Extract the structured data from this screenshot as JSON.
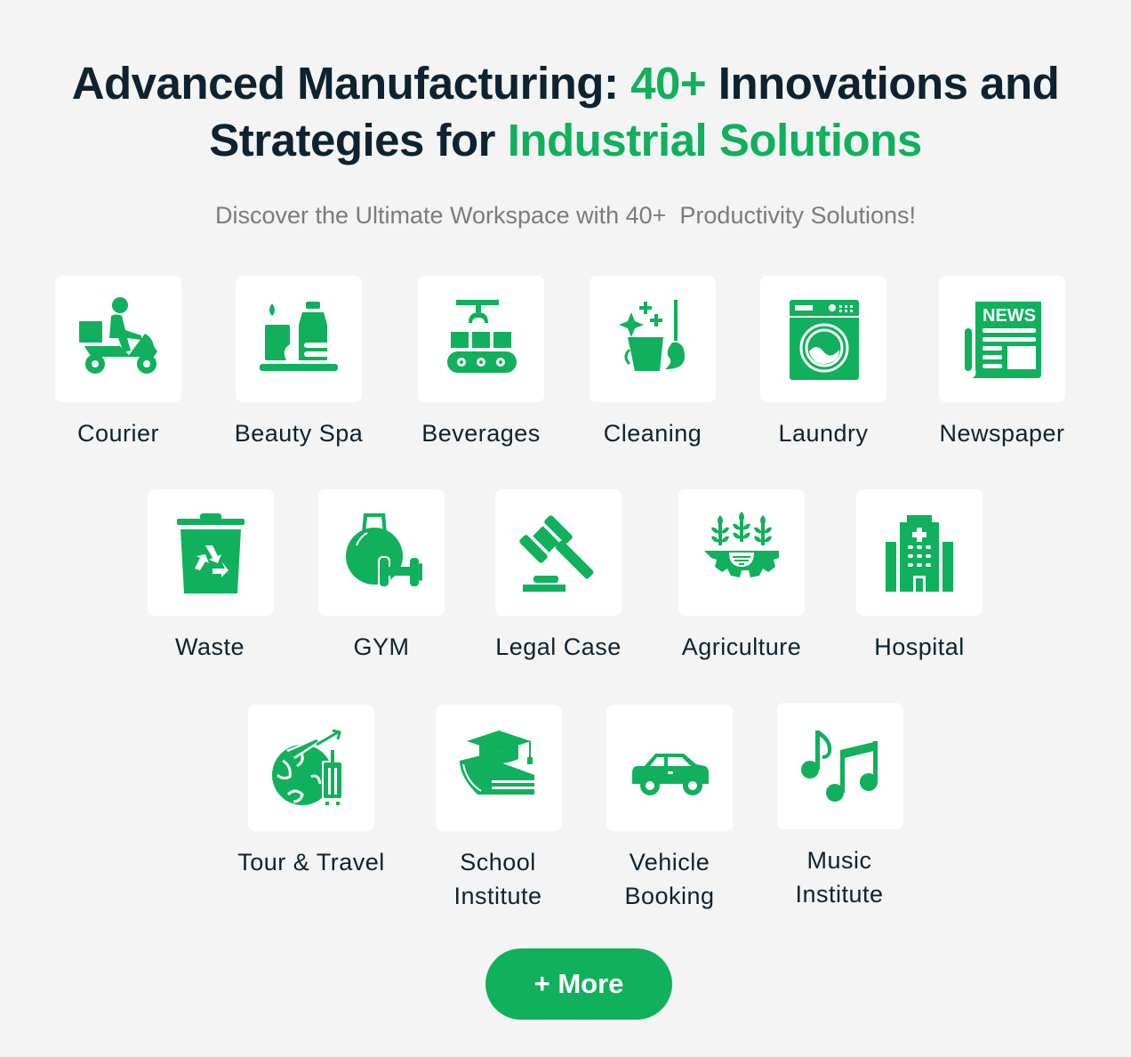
{
  "heading": {
    "line1_a": "Advanced Manufacturing: ",
    "line1_accent": "40+",
    "line1_b": " Innovations and",
    "line2_a": "Strategies for ",
    "line2_accent": "Industrial Solutions"
  },
  "subtitle": "Discover the Ultimate Workspace with 40+  Productivity Solutions!",
  "colors": {
    "accent": "#10b05c",
    "text": "#0e2230",
    "muted": "#7b7b7b",
    "background": "#f4f4f4",
    "card": "#ffffff"
  },
  "solutions": [
    {
      "label": "Courier",
      "icon": "scooter-delivery-icon"
    },
    {
      "label": "Beauty Spa",
      "icon": "spa-icon"
    },
    {
      "label": "Beverages",
      "icon": "conveyor-belt-icon"
    },
    {
      "label": "Cleaning",
      "icon": "cleaning-bucket-icon"
    },
    {
      "label": "Laundry",
      "icon": "washing-machine-icon"
    },
    {
      "label": "Newspaper",
      "icon": "newspaper-icon"
    },
    {
      "label": "Waste",
      "icon": "recycle-bin-icon"
    },
    {
      "label": "GYM",
      "icon": "kettlebell-dumbbell-icon"
    },
    {
      "label": "Legal Case",
      "icon": "gavel-icon"
    },
    {
      "label": "Agriculture",
      "icon": "agriculture-gear-icon"
    },
    {
      "label": "Hospital",
      "icon": "hospital-building-icon"
    },
    {
      "label": "Tour & Travel",
      "icon": "globe-plane-luggage-icon"
    },
    {
      "label_line1": "School",
      "label_line2": "Institute",
      "icon": "graduation-cap-book-icon"
    },
    {
      "label_line1": "Vehicle",
      "label_line2": "Booking",
      "icon": "car-icon"
    },
    {
      "label_line1": "Music",
      "label_line2": "Institute",
      "icon": "music-notes-icon"
    }
  ],
  "more_button": {
    "label": "+ More"
  }
}
